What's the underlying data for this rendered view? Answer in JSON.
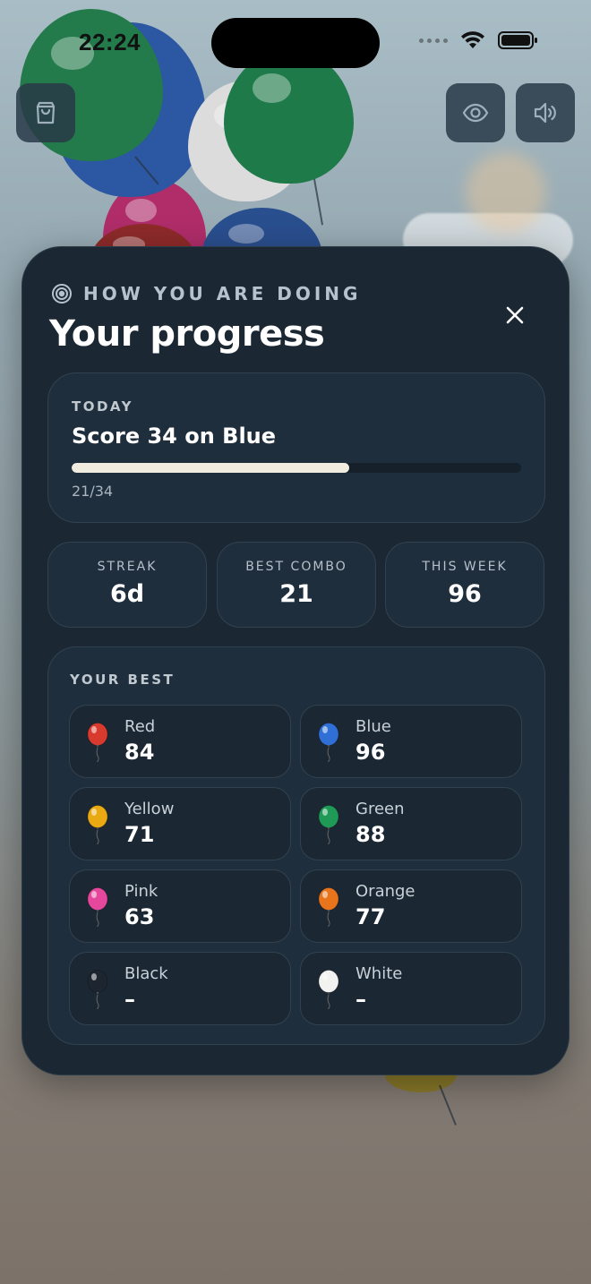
{
  "status_bar": {
    "time": "22:24"
  },
  "toolbar": {
    "shop_icon": "shopping-bag-icon",
    "visibility_icon": "eye-icon",
    "sound_icon": "speaker-icon"
  },
  "panel": {
    "eyebrow": "HOW YOU ARE DOING",
    "title": "Your progress",
    "close_icon": "close-icon"
  },
  "today": {
    "label": "TODAY",
    "goal": "Score 34 on Blue",
    "progress_text": "21/34",
    "progress_fraction": 0.618
  },
  "stats": [
    {
      "label": "STREAK",
      "value": "6d"
    },
    {
      "label": "BEST COMBO",
      "value": "21"
    },
    {
      "label": "THIS WEEK",
      "value": "96"
    }
  ],
  "best": {
    "label": "YOUR BEST",
    "items": [
      {
        "name": "Red",
        "score": "84",
        "color": "#d83a2e"
      },
      {
        "name": "Blue",
        "score": "96",
        "color": "#2f6fd6"
      },
      {
        "name": "Yellow",
        "score": "71",
        "color": "#e8a912"
      },
      {
        "name": "Green",
        "score": "88",
        "color": "#1f9a56"
      },
      {
        "name": "Pink",
        "score": "63",
        "color": "#e4479c"
      },
      {
        "name": "Orange",
        "score": "77",
        "color": "#e8741c"
      },
      {
        "name": "Black",
        "score": "–",
        "color": "#1c2530"
      },
      {
        "name": "White",
        "score": "–",
        "color": "#f2f2f0"
      }
    ]
  }
}
